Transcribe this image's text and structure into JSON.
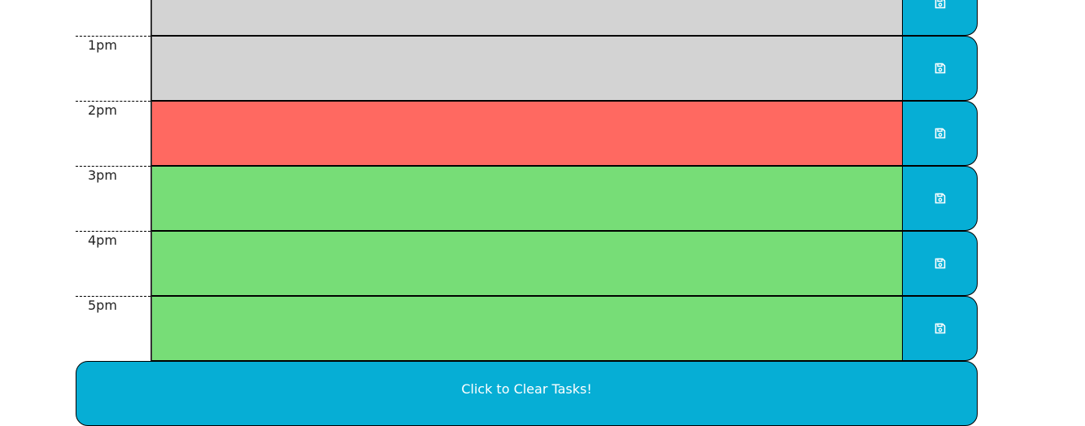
{
  "rows": [
    {
      "hour": "",
      "status": "past",
      "value": ""
    },
    {
      "hour": "1pm",
      "status": "past",
      "value": ""
    },
    {
      "hour": "2pm",
      "status": "present",
      "value": ""
    },
    {
      "hour": "3pm",
      "status": "future",
      "value": ""
    },
    {
      "hour": "4pm",
      "status": "future",
      "value": ""
    },
    {
      "hour": "5pm",
      "status": "future",
      "value": ""
    }
  ],
  "save_icon": "floppy-disk-icon",
  "clear_button_label": "Click to Clear Tasks!",
  "colors": {
    "past": "#d3d3d3",
    "present": "#ff6961",
    "future": "#77dd77",
    "button": "#06aed5"
  }
}
